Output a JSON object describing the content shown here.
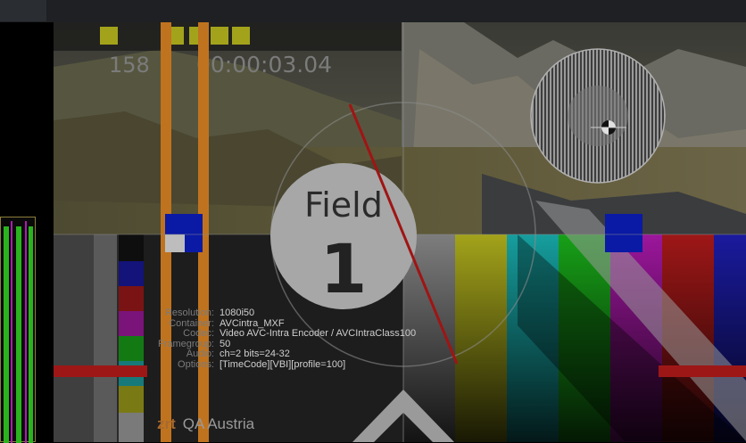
{
  "timecode": {
    "frame_number": "158",
    "time": "00:00:03.04"
  },
  "field": {
    "title": "Field",
    "number": "1"
  },
  "info": [
    {
      "label": "Resolution:",
      "value": "1080i50"
    },
    {
      "label": "Container:",
      "value": "AVCintra_MXF"
    },
    {
      "label": "Codec:",
      "value": "Video AVC-Intra Encoder / AVCIntraClass100"
    },
    {
      "label": "Framegroup:",
      "value": "50"
    },
    {
      "label": "Audio:",
      "value": "ch=2 bits=24-32"
    },
    {
      "label": "Options:",
      "value": "[TimeCode][VBI][profile=100]"
    }
  ],
  "logo": {
    "brand": "zrt",
    "text": "QA Austria"
  },
  "colors": {
    "bars": [
      "#b7b7b7",
      "#a3a31b",
      "#169e9e",
      "#17a017",
      "#9c169c",
      "#9e1717",
      "#1a1a9e"
    ],
    "orange": "#c0731e",
    "marker_blue": "#0a1aa5",
    "indicator_yellow": "#a3a31b",
    "meter_green": "#2bb31f",
    "meter_magenta": "#b019b3"
  },
  "icons": [
    "zone-plate-circle-icon",
    "crosshair-target-icon"
  ]
}
